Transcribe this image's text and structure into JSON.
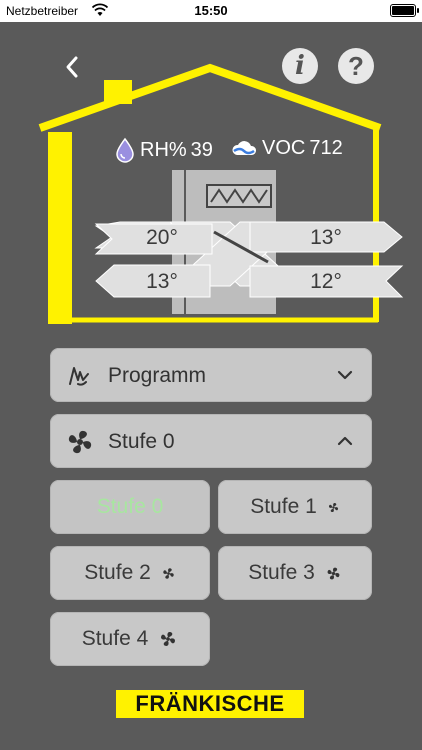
{
  "status_bar": {
    "carrier": "Netzbetreiber",
    "time": "15:50"
  },
  "nav": {
    "back_icon": "chevron-left-icon",
    "info_label": "i",
    "help_label": "?"
  },
  "readouts": {
    "rh_label": "RH%",
    "rh_value": "39",
    "voc_label": "VOC",
    "voc_value": "712"
  },
  "temperatures": {
    "top_left": "20°",
    "top_right": "13°",
    "bottom_left": "13°",
    "bottom_right": "12°"
  },
  "program_dropdown": {
    "label": "Programm",
    "icon": "hand-icon",
    "expanded": false
  },
  "stage_dropdown": {
    "label": "Stufe 0",
    "icon": "fan-icon",
    "expanded": true
  },
  "stages": [
    {
      "label": "Stufe 0",
      "active": true
    },
    {
      "label": "Stufe 1",
      "active": false
    },
    {
      "label": "Stufe 2",
      "active": false
    },
    {
      "label": "Stufe 3",
      "active": false
    },
    {
      "label": "Stufe 4",
      "active": false
    }
  ],
  "brand": {
    "logo_text": "FRÄNKISCHE",
    "accent": "#fff200",
    "active_text": "#a8e6a0"
  }
}
